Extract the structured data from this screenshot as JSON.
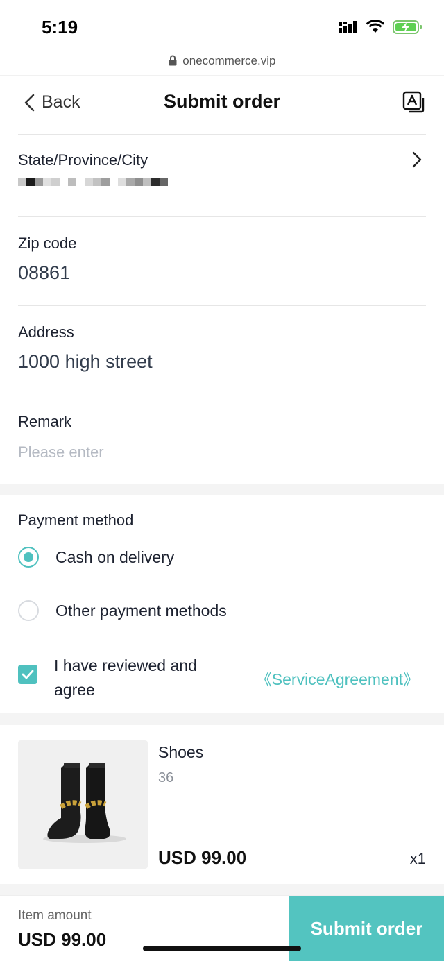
{
  "status_bar": {
    "time": "5:19"
  },
  "browser": {
    "url": "onecommerce.vip"
  },
  "nav": {
    "back_label": "Back",
    "title": "Submit order"
  },
  "form": {
    "region": {
      "label": "State/Province/City"
    },
    "zip": {
      "label": "Zip code",
      "value": "08861"
    },
    "address": {
      "label": "Address",
      "value": "1000 high street"
    },
    "remark": {
      "label": "Remark",
      "placeholder": "Please enter"
    }
  },
  "payment": {
    "title": "Payment method",
    "options": [
      {
        "label": "Cash on delivery",
        "selected": true
      },
      {
        "label": "Other payment methods",
        "selected": false
      }
    ],
    "agree_text": "I have reviewed and agree",
    "agree_link": "《ServiceAgreement》",
    "agree_checked": true
  },
  "product": {
    "name": "Shoes",
    "size": "36",
    "price": "USD 99.00",
    "quantity": "x1"
  },
  "footer": {
    "amount_label": "Item amount",
    "amount_value": "USD 99.00",
    "submit_label": "Submit order"
  },
  "colors": {
    "accent": "#53c4c0",
    "placeholder": "#b5bac3"
  }
}
